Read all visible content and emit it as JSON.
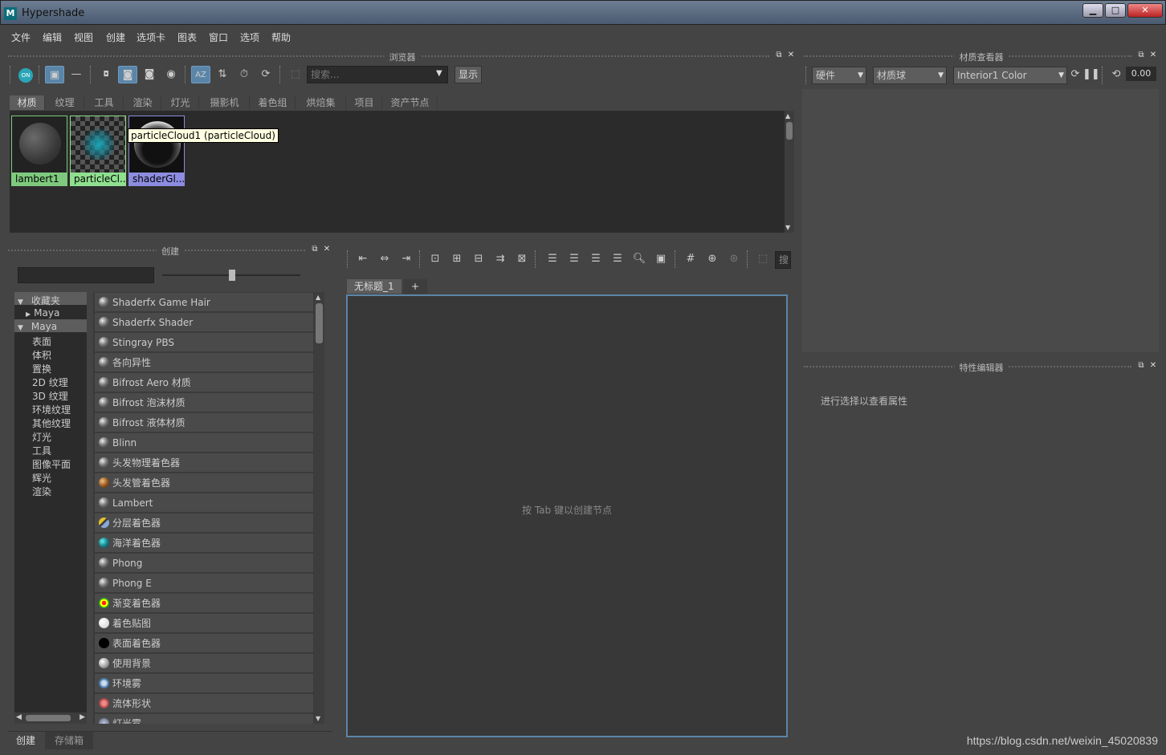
{
  "window": {
    "title": "Hypershade",
    "logo": "M"
  },
  "menu": [
    "文件",
    "编辑",
    "视图",
    "创建",
    "选项卡",
    "图表",
    "窗口",
    "选项",
    "帮助"
  ],
  "browser": {
    "header": "浏览器",
    "search_placeholder": "搜索...",
    "show_button": "显示",
    "tabs": [
      "材质",
      "纹理",
      "工具",
      "渲染",
      "灯光",
      "摄影机",
      "着色组",
      "烘焙集",
      "项目",
      "资产节点"
    ],
    "swatches": [
      {
        "name": "lambert1",
        "color": "#7ec97e"
      },
      {
        "name": "particleCl...",
        "color": "#8fdf8f"
      },
      {
        "name": "shaderGl...",
        "color": "#8c8ce0"
      }
    ],
    "tooltip": "particleCloud1 (particleCloud)"
  },
  "create": {
    "header": "创建",
    "tree": [
      {
        "label": "收藏夹",
        "expanded": true
      },
      {
        "label": "Maya",
        "expanded": false,
        "child": true
      },
      {
        "label": "Maya",
        "expanded": true
      },
      {
        "label": "表面"
      },
      {
        "label": "体积"
      },
      {
        "label": "置换"
      },
      {
        "label": "2D 纹理"
      },
      {
        "label": "3D 纹理"
      },
      {
        "label": "环境纹理"
      },
      {
        "label": "其他纹理"
      },
      {
        "label": "灯光"
      },
      {
        "label": "工具"
      },
      {
        "label": "图像平面"
      },
      {
        "label": "辉光"
      },
      {
        "label": "渲染"
      }
    ],
    "items": [
      {
        "label": "Shaderfx Game Hair",
        "icon": "sphere-icon"
      },
      {
        "label": "Shaderfx Shader",
        "icon": "sphere-icon"
      },
      {
        "label": "Stingray PBS",
        "icon": "sphere-icon"
      },
      {
        "label": "各向异性",
        "icon": "sphere-icon"
      },
      {
        "label": "Bifrost Aero 材质",
        "icon": "sphere-icon"
      },
      {
        "label": "Bifrost 泡沫材质",
        "icon": "sphere-icon"
      },
      {
        "label": "Bifrost 液体材质",
        "icon": "sphere-icon"
      },
      {
        "label": "Blinn",
        "icon": "sphere-icon"
      },
      {
        "label": "头发物理着色器",
        "icon": "sphere-icon"
      },
      {
        "label": "头发管着色器",
        "icon": "hair-tube-icon"
      },
      {
        "label": "Lambert",
        "icon": "sphere-icon"
      },
      {
        "label": "分层着色器",
        "icon": "layered-icon"
      },
      {
        "label": "海洋着色器",
        "icon": "ocean-icon"
      },
      {
        "label": "Phong",
        "icon": "sphere-icon"
      },
      {
        "label": "Phong E",
        "icon": "sphere-icon"
      },
      {
        "label": "渐变着色器",
        "icon": "ramp-icon"
      },
      {
        "label": "着色贴图",
        "icon": "white-sphere-icon"
      },
      {
        "label": "表面着色器",
        "icon": "black-sphere-icon"
      },
      {
        "label": "使用背景",
        "icon": "background-icon"
      },
      {
        "label": "环境雾",
        "icon": "fog-icon"
      },
      {
        "label": "流体形状",
        "icon": "fluid-icon"
      },
      {
        "label": "灯光雾",
        "icon": "light-fog-icon"
      }
    ],
    "bottom_tabs": [
      "创建",
      "存储箱"
    ]
  },
  "graph": {
    "tab": "无标题_1",
    "add_tab": "+",
    "hint": "按 Tab 键以创建节点",
    "search_label": "搜"
  },
  "material_viewer": {
    "header": "材质查看器",
    "renderer": "硬件",
    "shape": "材质球",
    "env": "Interior1 Color",
    "value": "0.00"
  },
  "attribute_editor": {
    "header": "特性编辑器",
    "message": "进行选择以查看属性"
  },
  "watermark": "https://blog.csdn.net/weixin_45020839"
}
